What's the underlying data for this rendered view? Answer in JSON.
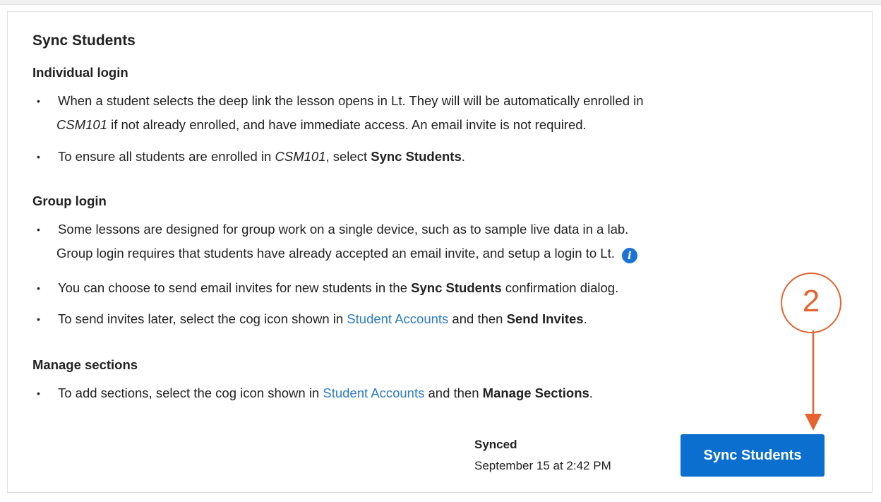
{
  "title": "Sync Students",
  "individual": {
    "heading": "Individual login",
    "bullet1_a": "When a student selects the deep link the lesson opens in Lt. They will will be automatically enrolled in",
    "bullet1_course": "CSM101",
    "bullet1_b": " if not already enrolled, and have immediate access. An email invite is not required.",
    "bullet2_a": "To ensure all students are enrolled in ",
    "bullet2_course": "CSM101",
    "bullet2_b": ", select ",
    "bullet2_bold": "Sync Students",
    "bullet2_c": "."
  },
  "group": {
    "heading": "Group login",
    "bullet1_a": "Some lessons are designed for group work on a single device, such as to sample live data in a lab.",
    "bullet1_b": "Group login requires that students have already accepted an email invite, and setup a login to Lt.",
    "bullet2_a": "You can choose to send email invites for new students in the ",
    "bullet2_bold": "Sync Students",
    "bullet2_b": " confirmation dialog.",
    "bullet3_a": "To send invites later, select the cog icon shown in ",
    "bullet3_link": "Student Accounts",
    "bullet3_b": " and then ",
    "bullet3_bold": "Send Invites",
    "bullet3_c": "."
  },
  "sections": {
    "heading": "Manage sections",
    "bullet1_a": "To add sections, select the cog icon shown in ",
    "bullet1_link": "Student Accounts",
    "bullet1_b": " and then ",
    "bullet1_bold": "Manage Sections",
    "bullet1_c": "."
  },
  "status": {
    "label": "Synced",
    "time": "September 15 at 2:42 PM"
  },
  "button": {
    "label": "Sync Students"
  },
  "annotation": {
    "number": "2"
  },
  "icons": {
    "bullet": "•",
    "info": "i"
  },
  "colors": {
    "accent": "#0a6fce",
    "link": "#2f7cc6",
    "annotation": "#e46330"
  }
}
